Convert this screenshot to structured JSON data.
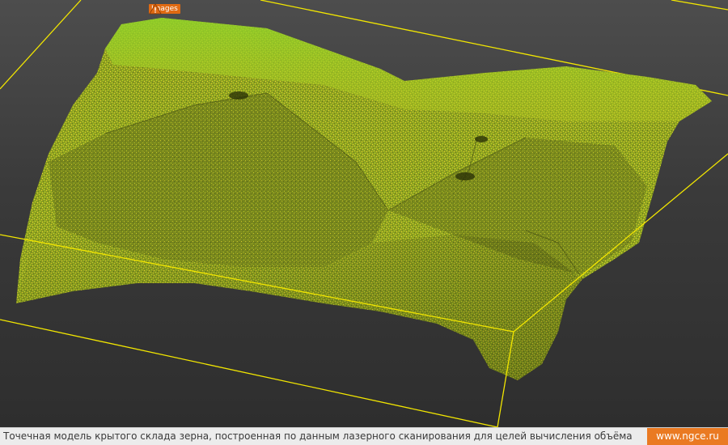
{
  "viewport": {
    "layer_label": "Images",
    "layer_icon": "warning-triangle-icon",
    "bounding_box_color": "#f2e600",
    "point_cloud_colors": [
      "#6fbf1e",
      "#c9d41a",
      "#e8c826",
      "#b0a022"
    ]
  },
  "footer": {
    "caption": "Точечная модель крытого склада зерна, построенная по данным лазерного сканирования для целей вычисления объёма",
    "site_link": "www.ngce.ru",
    "accent_color": "#ea7a22"
  }
}
